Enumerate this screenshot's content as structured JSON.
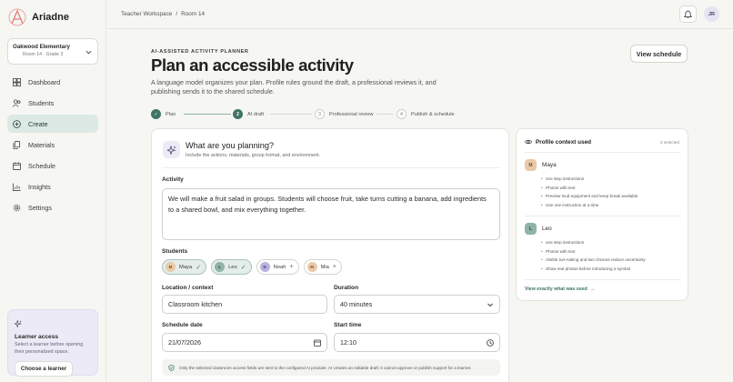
{
  "brand": {
    "name": "Ariadne"
  },
  "school": {
    "name": "Oakwood Elementary",
    "sub": "Room 14 · Grade 3"
  },
  "nav": [
    {
      "label": "Dashboard",
      "icon": "dashboard-icon"
    },
    {
      "label": "Students",
      "icon": "students-icon"
    },
    {
      "label": "Create",
      "icon": "plus-circle-icon",
      "active": true
    },
    {
      "label": "Materials",
      "icon": "materials-icon"
    },
    {
      "label": "Schedule",
      "icon": "calendar-icon"
    },
    {
      "label": "Insights",
      "icon": "chart-icon"
    },
    {
      "label": "Settings",
      "icon": "gear-icon"
    }
  ],
  "learner_access": {
    "title": "Learner access",
    "text": "Select a learner before opening their personalized space.",
    "button": "Choose a learner"
  },
  "topbar": {
    "crumb_1": "Teacher Workspace",
    "crumb_sep": "/",
    "crumb_2": "Room 14",
    "user_initials": "JR"
  },
  "header": {
    "eyebrow": "AI-ASSISTED ACTIVITY PLANNER",
    "title": "Plan an accessible activity",
    "description": "A language model organizes your plan. Profile rules ground the draft, a professional reviews it, and publishing sends it to the shared schedule.",
    "view_schedule": "View schedule"
  },
  "steps": [
    {
      "num": "✓",
      "label": "Plan",
      "state": "done"
    },
    {
      "num": "2",
      "label": "AI draft",
      "state": "current"
    },
    {
      "num": "3",
      "label": "Professional review",
      "state": "pending"
    },
    {
      "num": "4",
      "label": "Publish & schedule",
      "state": "pending"
    }
  ],
  "form": {
    "title": "What are you planning?",
    "subtitle": "Include the actions, materials, group format, and environment.",
    "activity_label": "Activity",
    "activity_value": "We will make a fruit salad in groups. Students will choose fruit, take turns cutting a banana, add ingredients to a shared bowl, and mix everything together.",
    "students_label": "Students",
    "students": [
      {
        "initial": "M",
        "name": "Maya",
        "selected": true,
        "color": "#e9c9a8"
      },
      {
        "initial": "L",
        "name": "Leo",
        "selected": true,
        "color": "#8fb3a7"
      },
      {
        "initial": "N",
        "name": "Noah",
        "selected": false,
        "color": "#b8b2de"
      },
      {
        "initial": "M",
        "name": "Mia",
        "selected": false,
        "color": "#e9c9a8"
      }
    ],
    "location_label": "Location / context",
    "location_value": "Classroom kitchen",
    "duration_label": "Duration",
    "duration_value": "40 minutes",
    "date_label": "Schedule date",
    "date_value": "21/07/2026",
    "time_label": "Start time",
    "time_value": "12:10",
    "notice": "Only the selected classroom access fields are sent to the configured AI provider. AI creates an editable draft; it cannot approve or publish support for a learner."
  },
  "profile_panel": {
    "title": "Profile context used",
    "count": "2 selected",
    "students": [
      {
        "initial": "M",
        "name": "Maya",
        "color": "#e9c9a8",
        "text_color": "#7a5230",
        "items": [
          "one step instructions",
          "Photos with text",
          "Preview loud equipment and keep break available",
          "Use one instruction at a time"
        ]
      },
      {
        "initial": "L",
        "name": "Leo",
        "color": "#8fb3a7",
        "text_color": "#24473d",
        "items": [
          "one step instructions",
          "Photos with text",
          "Visible turn-taking and two choices reduce uncertainty",
          "Show real photos before introducing a symbol"
        ]
      }
    ],
    "link": "View exactly what was used"
  }
}
